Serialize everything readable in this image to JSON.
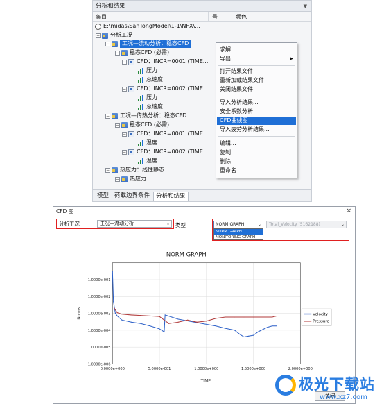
{
  "top_panel": {
    "title": "分析和结果",
    "columns": [
      "条目",
      "号",
      "颜色"
    ],
    "tree": [
      {
        "label": "E:\\midas\\SanTongModel\\1-1\\NFX\\...",
        "icon": "compass-icon"
      },
      {
        "label": "分析工况",
        "icon": "folder-icon"
      },
      {
        "label": "工况—流动分析：稳态CFD",
        "icon": "folder-icon"
      },
      {
        "label": "稳态CFD (必需)",
        "icon": "folder-icon"
      },
      {
        "label": "CFD：INCR=0001 (TIME...",
        "icon": "result-icon"
      },
      {
        "label": "压力",
        "icon": "bar-chart-icon"
      },
      {
        "label": "总速度",
        "icon": "bar-chart-icon"
      },
      {
        "label": "CFD：INCR=0002 (TIME...",
        "icon": "result-icon"
      },
      {
        "label": "压力",
        "icon": "bar-chart-icon"
      },
      {
        "label": "总速度",
        "icon": "bar-chart-icon"
      },
      {
        "label": "工况—传热分析：稳态CFD",
        "icon": "folder-icon"
      },
      {
        "label": "稳态CFD (必需)",
        "icon": "folder-icon"
      },
      {
        "label": "CFD：INCR=0001 (TIME...",
        "icon": "result-icon"
      },
      {
        "label": "温度",
        "icon": "bar-chart-icon"
      },
      {
        "label": "CFD：INCR=0002 (TIME...",
        "icon": "result-icon"
      },
      {
        "label": "温度",
        "icon": "bar-chart-icon"
      },
      {
        "label": "热应力：线性静态",
        "icon": "folder-icon"
      },
      {
        "label": "热应力",
        "icon": "folder-icon"
      }
    ],
    "bottom_tabs": [
      "模型",
      "荷载边界条件",
      "分析和结果"
    ],
    "active_tab": "分析和结果"
  },
  "context_menu": {
    "items": [
      "求解",
      "导出",
      "打开结果文件",
      "重新加载结果文件",
      "关闭结果文件",
      "导入分析结果...",
      "安全系数分析",
      "CFD曲线图",
      "导入疲劳分析结果...",
      "编辑...",
      "复制",
      "删除",
      "重命名"
    ],
    "highlighted": "CFD曲线图"
  },
  "dialog": {
    "title": "CFD 图",
    "close_glyph": "×",
    "case_label": "分析工况",
    "case_value": "工况—流动分析",
    "type_label": "类型",
    "graph_value": "NORM GRAPH",
    "graph_options": [
      "NORM GRAPH",
      "MONITORING GRAPH"
    ],
    "variable_value": "Total_Velocity (5162188)",
    "close_button": "关闭"
  },
  "chart_data": {
    "type": "line",
    "title": "NORM GRAPH",
    "xlabel": "TIME",
    "ylabel": "Norms",
    "xlim": [
      0,
      2.0
    ],
    "ylim": [
      1e-06,
      1.0
    ],
    "yscale": "log",
    "xticks": [
      "0.0000e+000",
      "5.0000e-001",
      "1.0000e+000",
      "1.5000e+000",
      "2.0000e+000"
    ],
    "yticks": [
      "1.0000e-006",
      "1.0000e-005",
      "1.0000e-004",
      "1.0000e-003",
      "1.0000e-002",
      "1.0000e-001"
    ],
    "grid": true,
    "legend_position": "right",
    "series": [
      {
        "name": "Velocity",
        "color": "#2b5fc7",
        "x": [
          0.0,
          0.01,
          0.03,
          0.05,
          0.1,
          0.2,
          0.3,
          0.4,
          0.5,
          0.55,
          0.56,
          0.7,
          0.9,
          1.1,
          1.2,
          1.3,
          1.35,
          1.4,
          1.45,
          1.5,
          1.55,
          1.6,
          1.65,
          1.7,
          1.75
        ],
        "y": [
          0.3,
          0.005,
          0.001,
          0.0007,
          0.0004,
          0.0003,
          0.00025,
          0.00018,
          0.00012,
          8e-05,
          0.0008,
          0.00045,
          0.00028,
          0.00018,
          0.00013,
          0.0001,
          6e-05,
          4e-05,
          4.5e-05,
          5e-05,
          8e-05,
          0.00011,
          0.00015,
          0.00018,
          0.00018
        ]
      },
      {
        "name": "Pressure",
        "color": "#b03a3a",
        "x": [
          0.02,
          0.05,
          0.1,
          0.2,
          0.3,
          0.4,
          0.5,
          0.6,
          0.7,
          0.8,
          0.9,
          1.0,
          1.1,
          1.2,
          1.3,
          1.4,
          1.5,
          1.6,
          1.7,
          1.75
        ],
        "y": [
          0.002,
          0.0011,
          0.0009,
          0.0008,
          0.00075,
          0.0007,
          0.00065,
          0.00025,
          0.0003,
          0.0004,
          0.0003,
          0.00035,
          0.0005,
          0.0006,
          0.0006,
          0.0006,
          0.0006,
          0.0006,
          0.0006,
          0.0007
        ]
      }
    ]
  },
  "watermark": {
    "brand": "极光下载站",
    "url": "www.xz7.com"
  }
}
